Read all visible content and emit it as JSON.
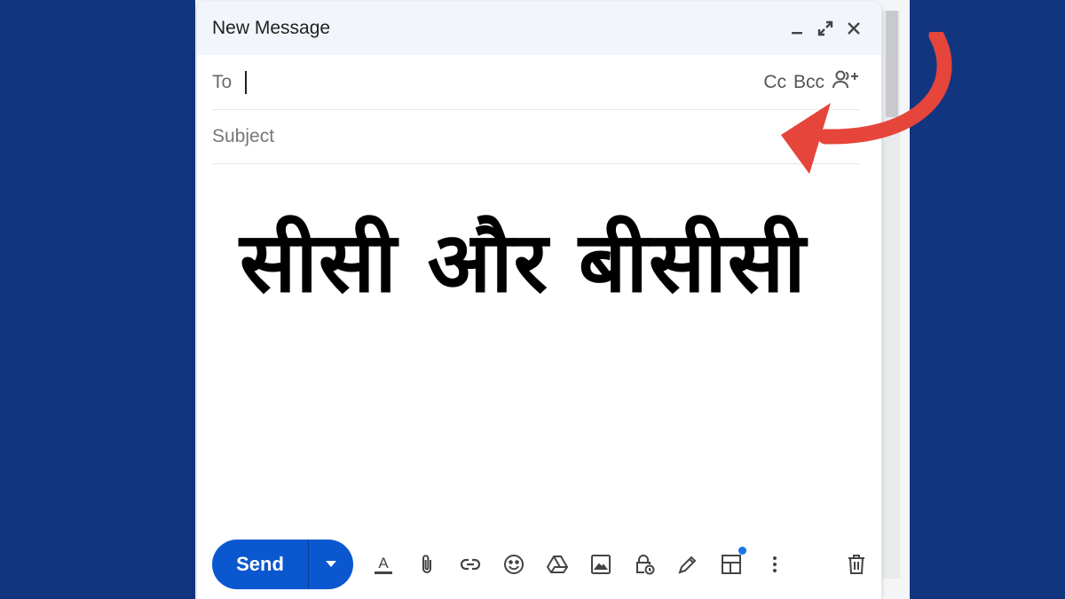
{
  "compose": {
    "title": "New Message",
    "to_label": "To",
    "to_value": "",
    "cc_label": "Cc",
    "bcc_label": "Bcc",
    "subject_placeholder": "Subject",
    "body_heading": "सीसी और बीसीसी"
  },
  "toolbar": {
    "send_label": "Send",
    "format_icon_glyph": "A"
  },
  "icons": {
    "minimize": "minimize-icon",
    "expand": "expand-icon",
    "close": "close-icon",
    "add_recipients": "add-recipients-icon",
    "send_options": "chevron-down-icon",
    "formatting": "text-format-icon",
    "attach": "paperclip-icon",
    "link": "link-icon",
    "emoji": "emoji-icon",
    "drive": "drive-icon",
    "photo": "image-icon",
    "confidential": "lock-clock-icon",
    "signature": "pen-icon",
    "layouts": "layout-icon",
    "more": "more-vert-icon",
    "discard": "trash-icon"
  },
  "colors": {
    "background": "#123580",
    "send_button": "#0b57d0",
    "arrow": "#e5453b",
    "notification_dot": "#1a73e8"
  }
}
